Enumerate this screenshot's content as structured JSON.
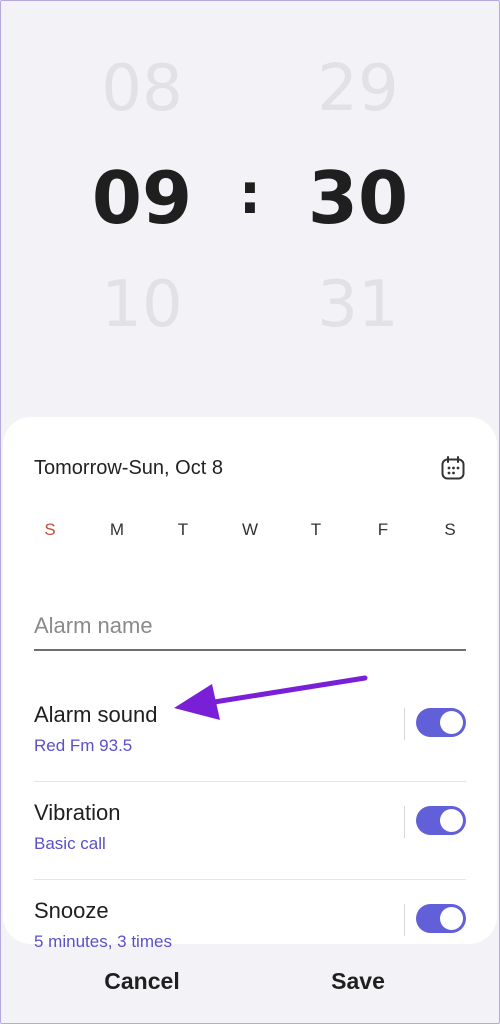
{
  "time_picker": {
    "hour_prev": "08",
    "hour": "09",
    "hour_next": "10",
    "separator": ":",
    "minute_prev": "29",
    "minute": "30",
    "minute_next": "31"
  },
  "card": {
    "date": "Tomorrow-Sun, Oct 8",
    "calendar_icon": "calendar-icon",
    "days": [
      "S",
      "M",
      "T",
      "W",
      "T",
      "F",
      "S"
    ],
    "alarm_name_placeholder": "Alarm name",
    "settings": [
      {
        "title": "Alarm sound",
        "subtitle": "Red Fm 93.5",
        "enabled": true
      },
      {
        "title": "Vibration",
        "subtitle": "Basic call",
        "enabled": true
      },
      {
        "title": "Snooze",
        "subtitle": "5 minutes, 3 times",
        "enabled": true
      }
    ]
  },
  "footer": {
    "cancel_label": "Cancel",
    "save_label": "Save"
  },
  "colors": {
    "accent": "#6160d8",
    "subtitle": "#5a50c8",
    "sunday": "#c14c3a",
    "annotation_arrow": "#7a1fd8"
  }
}
